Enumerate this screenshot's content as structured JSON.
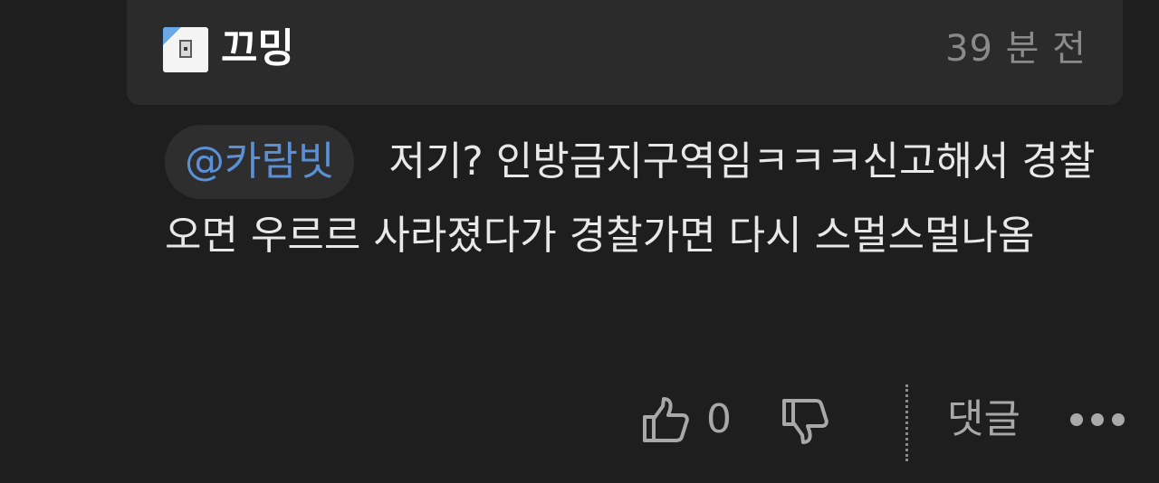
{
  "header": {
    "author": "끄밍",
    "time": "39 분 전"
  },
  "comment": {
    "mention": "@카람빗",
    "text": "저기? 인방금지구역임ㅋㅋㅋ신고해서 경찰오면 우르르 사라졌다가 경찰가면 다시 스멀스멀나옴"
  },
  "actions": {
    "like_count": "0",
    "reply_label": "댓글"
  },
  "icons": {
    "like": "thumbs-up-icon",
    "dislike": "thumbs-down-icon",
    "more": "more-horizontal-icon"
  },
  "colors": {
    "background": "#1e1e1e",
    "header_card": "#2b2b2b",
    "mention_text": "#5b8fd6",
    "muted": "#a8a8a8"
  }
}
